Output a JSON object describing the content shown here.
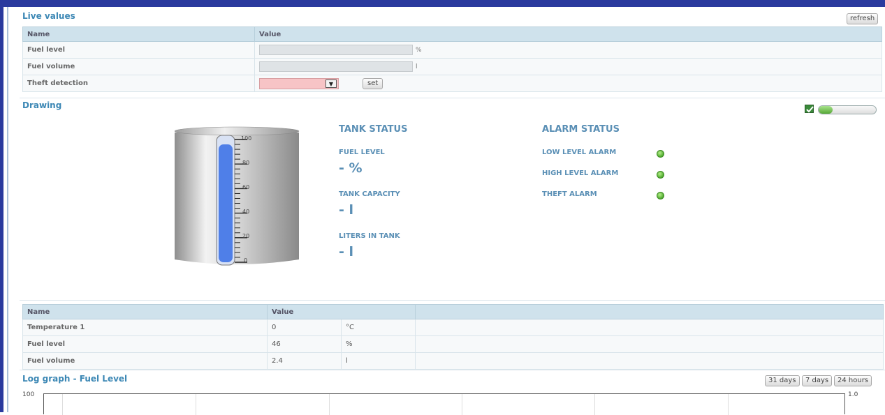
{
  "live_values": {
    "title": "Live values",
    "refresh_label": "refresh",
    "col_name": "Name",
    "col_value": "Value",
    "rows": [
      {
        "name": "Fuel level",
        "unit": "%"
      },
      {
        "name": "Fuel volume",
        "unit": "l"
      },
      {
        "name": "Theft detection"
      }
    ],
    "set_label": "set",
    "select_color": "#f7c4c6"
  },
  "drawing": {
    "title": "Drawing",
    "tank": {
      "ticks": [
        "100",
        "80",
        "60",
        "40",
        "20",
        "0"
      ],
      "fill_level": 0.96,
      "fill_color": "#4f7fe8"
    },
    "tank_status": {
      "heading": "TANK STATUS",
      "fuel_level_label": "FUEL LEVEL",
      "fuel_level_value": "- %",
      "tank_capacity_label": "TANK CAPACITY",
      "tank_capacity_value": "- l",
      "liters_label": "LITERS IN TANK",
      "liters_value": "- l"
    },
    "alarm_status": {
      "heading": "ALARM STATUS",
      "alarms": [
        "LOW LEVEL ALARM",
        "HIGH LEVEL ALARM",
        "THEFT ALARM"
      ],
      "led_color": "#4faa2f"
    }
  },
  "sensors": {
    "col_name": "Name",
    "col_value": "Value",
    "rows": [
      {
        "name": "Temperature 1",
        "value": "0",
        "unit": "°C"
      },
      {
        "name": "Fuel level",
        "value": "46",
        "unit": "%"
      },
      {
        "name": "Fuel volume",
        "value": "2.4",
        "unit": "l"
      }
    ]
  },
  "log_graph": {
    "title": "Log graph - Fuel Level",
    "range_buttons": [
      "31 days",
      "7 days",
      "24 hours"
    ],
    "y_left_max": "100",
    "y_right_max": "1.0"
  }
}
